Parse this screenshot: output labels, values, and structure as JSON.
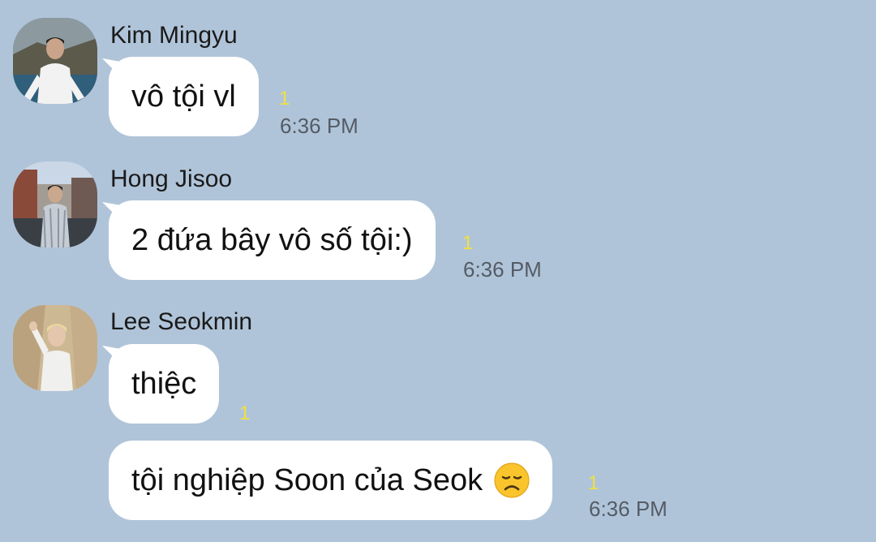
{
  "messages": [
    {
      "sender": "Kim Mingyu",
      "bubbles": [
        {
          "text": "vô tội vl",
          "unread": "1",
          "time": "6:36 PM"
        }
      ]
    },
    {
      "sender": "Hong Jisoo",
      "bubbles": [
        {
          "text": "2 đứa bây vô số tội:)",
          "unread": "1",
          "time": "6:36 PM"
        }
      ]
    },
    {
      "sender": "Lee Seokmin",
      "bubbles": [
        {
          "text": "thiệc",
          "unread": "1",
          "time": ""
        },
        {
          "text": "tội nghiệp Soon của Seok",
          "emoji": "disappointed-face-emoji",
          "unread": "1",
          "time": "6:36 PM"
        }
      ]
    }
  ],
  "colors": {
    "background": "#b0c4d9",
    "bubble": "#ffffff",
    "unread": "#f0e040",
    "time": "#545c66"
  }
}
